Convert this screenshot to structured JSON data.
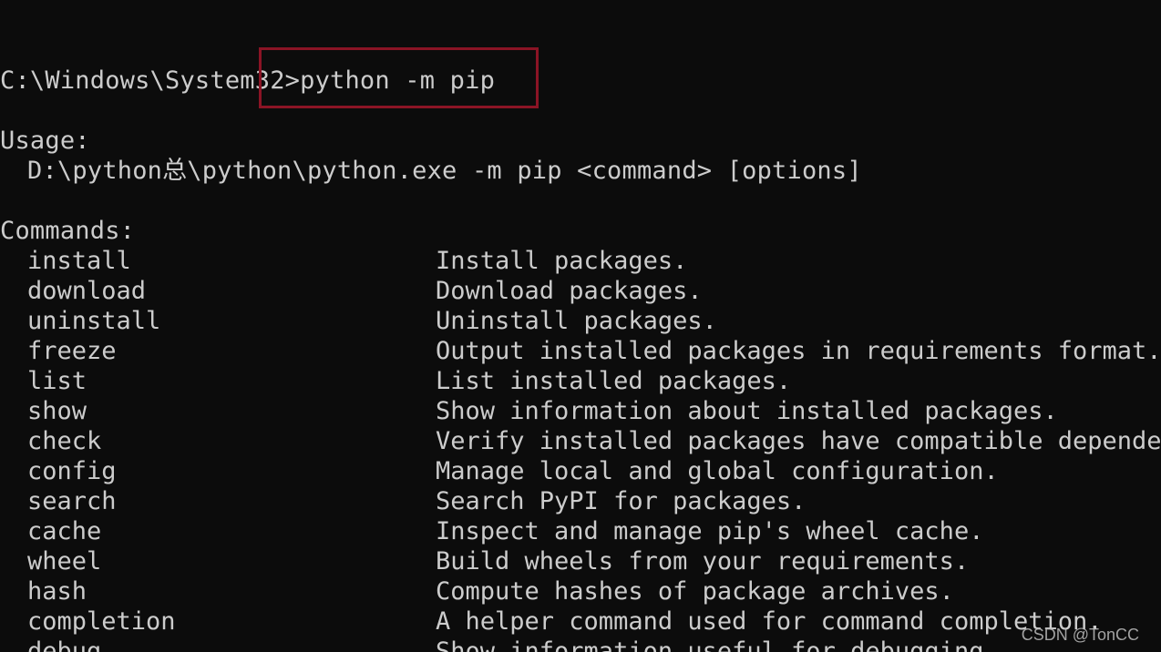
{
  "terminal": {
    "prompt": "C:\\Windows\\System32>",
    "command": "python -m pip",
    "usage_header": "Usage:",
    "usage_line": "D:\\python总\\python\\python.exe -m pip <command> [options]",
    "commands_header": "Commands:",
    "commands": [
      {
        "name": "install",
        "description": "Install packages."
      },
      {
        "name": "download",
        "description": "Download packages."
      },
      {
        "name": "uninstall",
        "description": "Uninstall packages."
      },
      {
        "name": "freeze",
        "description": "Output installed packages in requirements format."
      },
      {
        "name": "list",
        "description": "List installed packages."
      },
      {
        "name": "show",
        "description": "Show information about installed packages."
      },
      {
        "name": "check",
        "description": "Verify installed packages have compatible dependencies."
      },
      {
        "name": "config",
        "description": "Manage local and global configuration."
      },
      {
        "name": "search",
        "description": "Search PyPI for packages."
      },
      {
        "name": "cache",
        "description": "Inspect and manage pip's wheel cache."
      },
      {
        "name": "wheel",
        "description": "Build wheels from your requirements."
      },
      {
        "name": "hash",
        "description": "Compute hashes of package archives."
      },
      {
        "name": "completion",
        "description": "A helper command used for command completion."
      },
      {
        "name": "debug",
        "description": "Show information useful for debugging."
      }
    ]
  },
  "watermark": "CSDN @TonCC",
  "colors": {
    "background": "#0c0c0c",
    "text": "#cccccc",
    "highlight_border": "#8b1425"
  }
}
